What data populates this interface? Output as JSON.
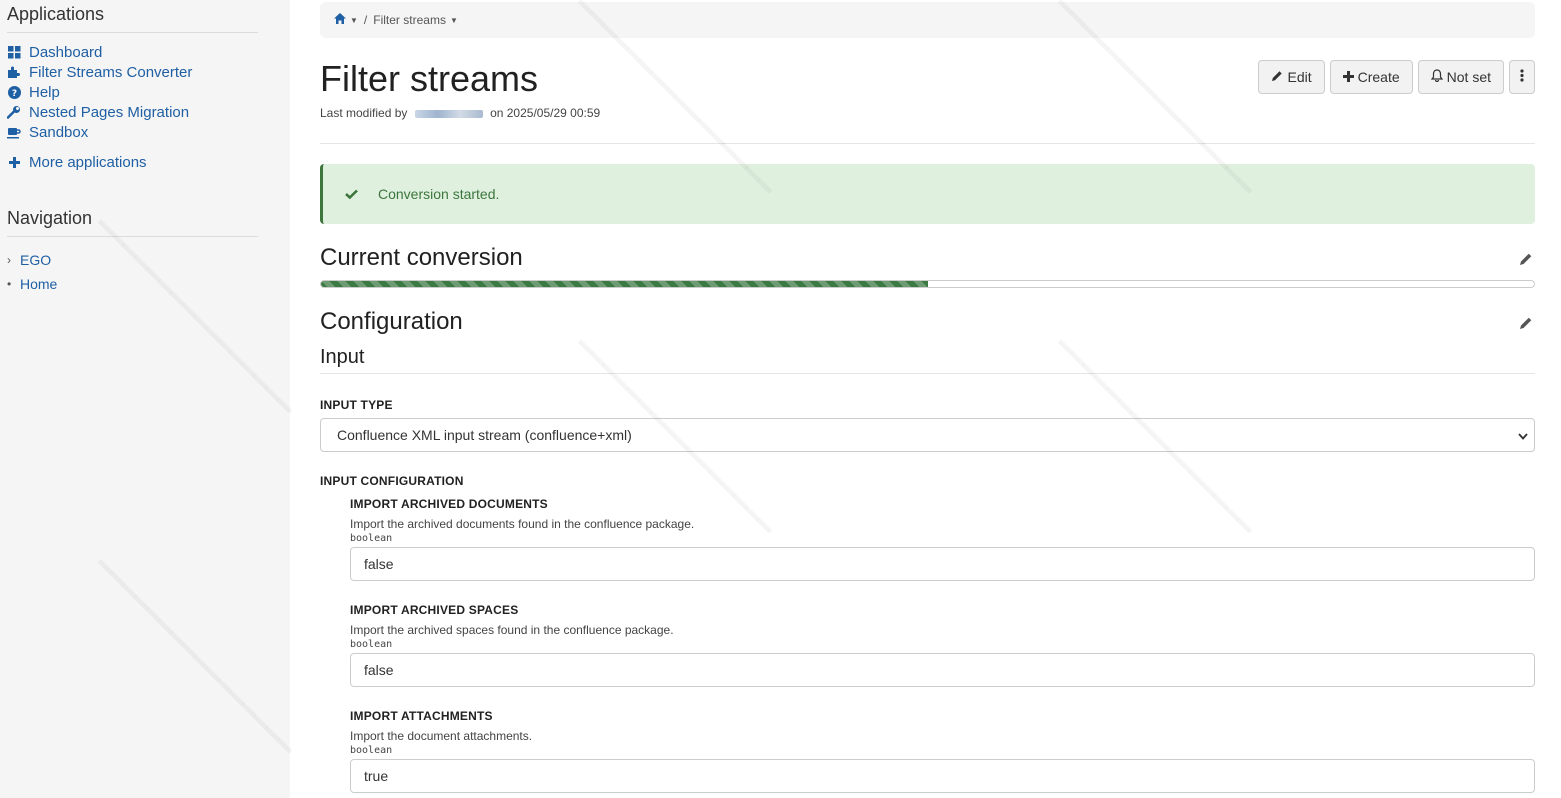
{
  "sidebar": {
    "applications_heading": "Applications",
    "apps": [
      {
        "label": "Dashboard",
        "icon": "dashboard-icon"
      },
      {
        "label": "Filter Streams Converter",
        "icon": "puzzle-icon"
      },
      {
        "label": "Help",
        "icon": "question-circle-icon"
      },
      {
        "label": "Nested Pages Migration",
        "icon": "wrench-icon"
      },
      {
        "label": "Sandbox",
        "icon": "coffee-icon"
      }
    ],
    "more_applications": "More applications",
    "navigation_heading": "Navigation",
    "nav": [
      {
        "label": "EGO",
        "marker": "›"
      },
      {
        "label": "Home",
        "marker": "•"
      }
    ]
  },
  "breadcrumb": {
    "current": "Filter streams",
    "separator": "/"
  },
  "page": {
    "title": "Filter streams",
    "modified_prefix": "Last modified by",
    "modified_on": "on 2025/05/29 00:59"
  },
  "actions": {
    "edit": "Edit",
    "create": "Create",
    "notifications": "Not set"
  },
  "alert": {
    "message": "Conversion started."
  },
  "conversion": {
    "title": "Current conversion",
    "progress": 0.5
  },
  "configuration": {
    "title": "Configuration",
    "input_title": "Input",
    "input_type_label": "INPUT TYPE",
    "input_type_value": "Confluence XML input stream (confluence+xml)",
    "input_config_label": "INPUT CONFIGURATION",
    "fields": [
      {
        "label": "IMPORT ARCHIVED DOCUMENTS",
        "hint": "Import the archived documents found in the confluence package.",
        "type": "boolean",
        "value": "false"
      },
      {
        "label": "IMPORT ARCHIVED SPACES",
        "hint": "Import the archived spaces found in the confluence package.",
        "type": "boolean",
        "value": "false"
      },
      {
        "label": "IMPORT ATTACHMENTS",
        "hint": "Import the document attachments.",
        "type": "boolean",
        "value": "true"
      }
    ]
  },
  "colors": {
    "link": "#1f5fa4",
    "success": "#3c763d",
    "success_bg": "#e0f0df",
    "progress": "#3c7a43"
  }
}
